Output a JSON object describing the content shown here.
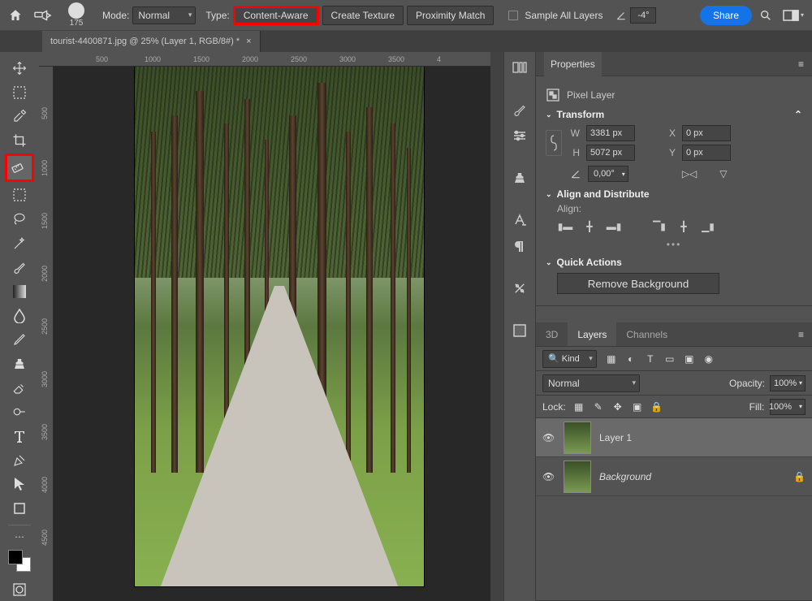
{
  "topbar": {
    "brush_size": "175",
    "mode_label": "Mode:",
    "mode_value": "Normal",
    "type_label": "Type:",
    "type_content_aware": "Content-Aware",
    "type_create_texture": "Create Texture",
    "type_proximity": "Proximity Match",
    "sample_all": "Sample All Layers",
    "angle_value": "-4°",
    "share": "Share"
  },
  "doc": {
    "title": "tourist-4400871.jpg @ 25% (Layer 1, RGB/8#) *"
  },
  "ruler_h": [
    "500",
    "1000",
    "1500",
    "2000",
    "2500",
    "3000",
    "3500",
    "4"
  ],
  "ruler_v": [
    "500",
    "1000",
    "1500",
    "2000",
    "2500",
    "3000",
    "3500",
    "4000",
    "4500"
  ],
  "properties": {
    "tab": "Properties",
    "layer_type": "Pixel Layer",
    "transform_label": "Transform",
    "w_label": "W",
    "w_value": "3381 px",
    "h_label": "H",
    "h_value": "5072 px",
    "x_label": "X",
    "x_value": "0 px",
    "y_label": "Y",
    "y_value": "0 px",
    "angle_value": "0,00°",
    "align_label": "Align and Distribute",
    "align_sub": "Align:",
    "quick_actions": "Quick Actions",
    "remove_bg": "Remove Background"
  },
  "layers": {
    "tab_3d": "3D",
    "tab_layers": "Layers",
    "tab_channels": "Channels",
    "kind": "Kind",
    "blend": "Normal",
    "opacity_label": "Opacity:",
    "opacity_value": "100%",
    "lock_label": "Lock:",
    "fill_label": "Fill:",
    "fill_value": "100%",
    "items": [
      {
        "name": "Layer 1",
        "selected": true,
        "locked": false
      },
      {
        "name": "Background",
        "selected": false,
        "locked": true
      }
    ]
  }
}
